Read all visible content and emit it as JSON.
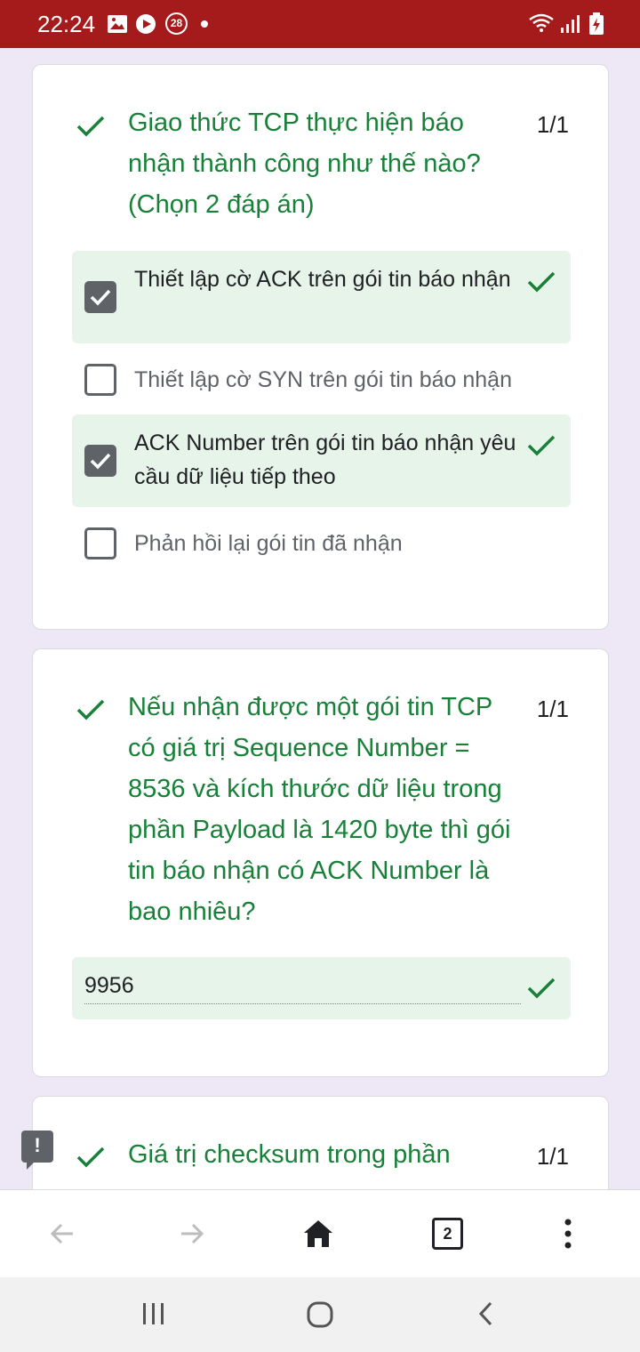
{
  "status_bar": {
    "time": "22:24",
    "notification_badge": "28",
    "icons": [
      "image-icon",
      "play-icon",
      "badge-icon",
      "dot-icon",
      "wifi-icon",
      "signal-icon",
      "battery-icon"
    ]
  },
  "questions": [
    {
      "status": "correct",
      "text": "Giao thức TCP thực hiện báo nhận thành công như thế nào? (Chọn 2 đáp án)",
      "score": "1/1",
      "options": [
        {
          "label": "Thiết lập cờ ACK trên gói tin báo nhận",
          "checked": true,
          "correct": true
        },
        {
          "label": "Thiết lập cờ SYN trên gói tin báo nhận",
          "checked": false,
          "correct": false
        },
        {
          "label": "ACK Number trên gói tin báo nhận yêu cầu dữ liệu tiếp theo",
          "checked": true,
          "correct": true
        },
        {
          "label": "Phản hồi lại gói tin đã nhận",
          "checked": false,
          "correct": false
        }
      ]
    },
    {
      "status": "correct",
      "text": "Nếu nhận được một gói tin TCP có giá trị Sequence Number = 8536 và kích thước dữ liệu trong phần Payload là 1420 byte thì gói tin báo nhận có ACK Number là bao nhiêu?",
      "score": "1/1",
      "answer": "9956"
    },
    {
      "status": "correct",
      "text": "Giá trị checksum trong phần",
      "score": "1/1"
    }
  ],
  "browser_toolbar": {
    "tabs_count": "2",
    "icons": [
      "back-arrow-icon",
      "forward-arrow-icon",
      "home-icon",
      "tabs-icon",
      "more-vert-icon"
    ]
  },
  "nav_bar": {
    "icons": [
      "recents-icon",
      "home-circle-icon",
      "back-icon"
    ]
  },
  "colors": {
    "status_bar": "#a51a1a",
    "page_background": "#ede7f6",
    "correct_green": "#188038",
    "correct_bg": "#e6f4ea",
    "checkbox_gray": "#5f6368"
  }
}
